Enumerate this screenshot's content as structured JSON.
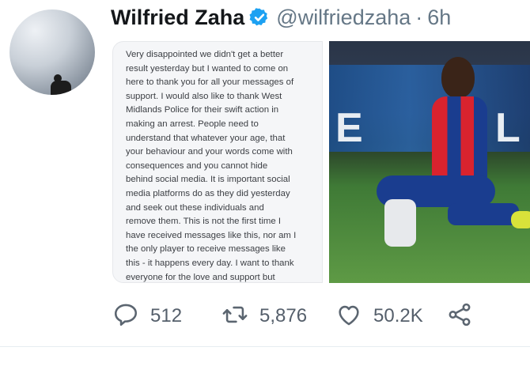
{
  "tweet": {
    "display_name": "Wilfried Zaha",
    "handle": "@wilfriedzaha",
    "separator": "·",
    "time": "6h",
    "statement": "Very disappointed we didn't get a better\nresult yesterday but I wanted to come on\nhere to thank you for all your messages of\nsupport. I would also like to thank West\nMidlands Police for their swift action in\nmaking an arrest. People need to\nunderstand that whatever your age, that\nyour behaviour and your words come with\nconsequences and you cannot hide\nbehind social media. It is important social\nmedia platforms do as they did yesterday\nand seek out these individuals and\nremove them. This is not the first time I\nhave received messages like this, nor am I\nthe only player to receive messages like\nthis - it happens every day. I want to thank\neveryone for the love and support but"
  },
  "actions": {
    "replies": "512",
    "retweets": "5,876",
    "likes": "50.2K"
  },
  "colors": {
    "verified": "#1da1f2",
    "icon": "#5b6570"
  }
}
